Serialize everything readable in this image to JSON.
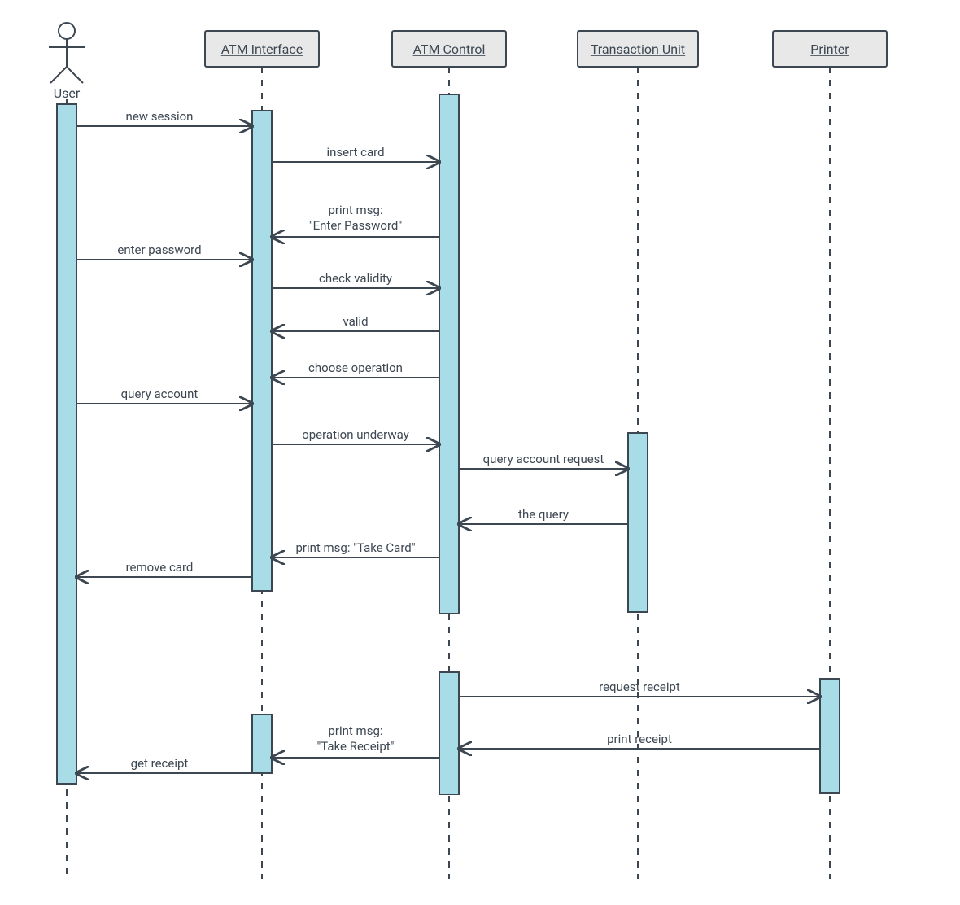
{
  "actor": {
    "name": "User"
  },
  "participants": {
    "p1": "ATM Interface",
    "p2": "ATM Control",
    "p3": "Transaction Unit",
    "p4": "Printer"
  },
  "messages": {
    "m1": "new session",
    "m2": "insert card",
    "m3a": "print msg:",
    "m3b": "\"Enter Password\"",
    "m4": "enter password",
    "m5": "check validity",
    "m6": "valid",
    "m7": "choose operation",
    "m8": "query account",
    "m9": "operation underway",
    "m10": "query account request",
    "m11": "the query",
    "m12": "print msg: \"Take Card\"",
    "m13": "remove card",
    "m14": "request receipt",
    "m15": "print receipt",
    "m16a": "print msg:",
    "m16b": "\"Take Receipt\"",
    "m17": "get receipt"
  }
}
